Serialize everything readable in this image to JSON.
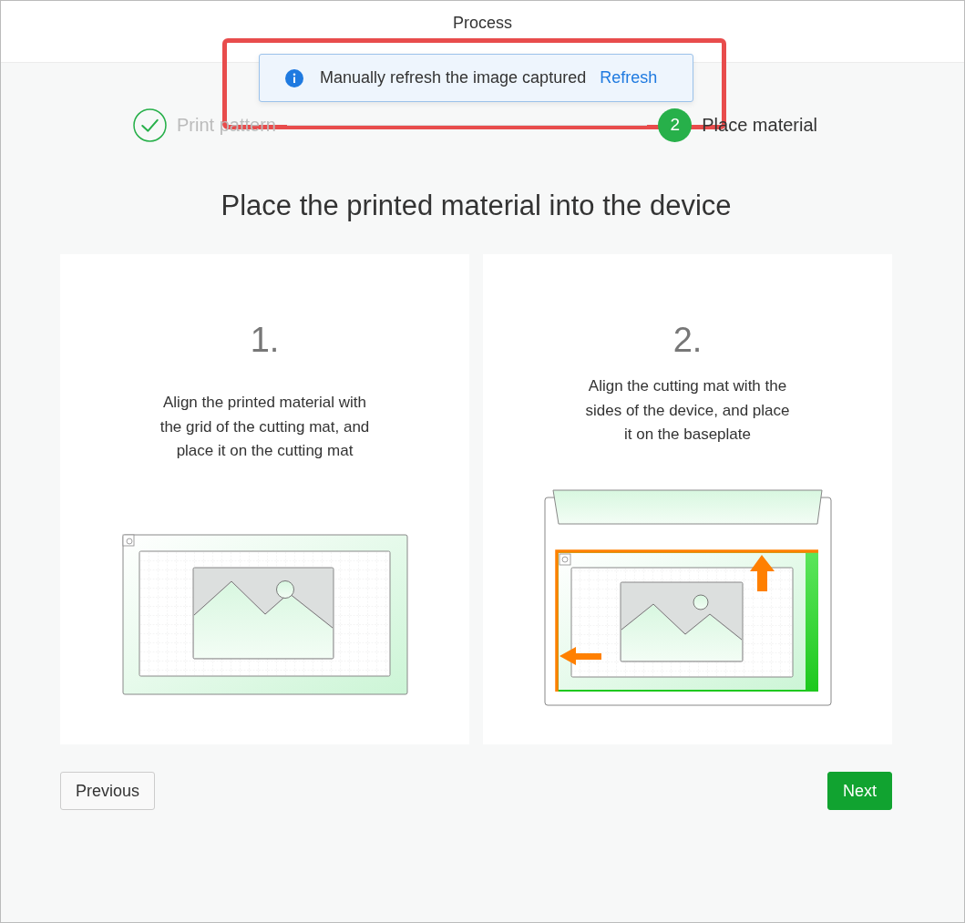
{
  "header": {
    "title": "Process"
  },
  "toast": {
    "message": "Manually refresh the image captured",
    "action": "Refresh"
  },
  "steps": [
    {
      "label": "Print pattern",
      "completed": true
    },
    {
      "label": "Place material",
      "number": "2",
      "completed": false
    }
  ],
  "heading": "Place the printed material into the device",
  "cards": [
    {
      "number": "1.",
      "text": "Align the printed material with the grid of the cutting mat, and place it on the cutting mat",
      "kind": "mat"
    },
    {
      "number": "2.",
      "text": "Align the cutting mat with the sides of the device, and place it on the baseplate",
      "kind": "device"
    }
  ],
  "buttons": {
    "previous": "Previous",
    "next": "Next"
  }
}
